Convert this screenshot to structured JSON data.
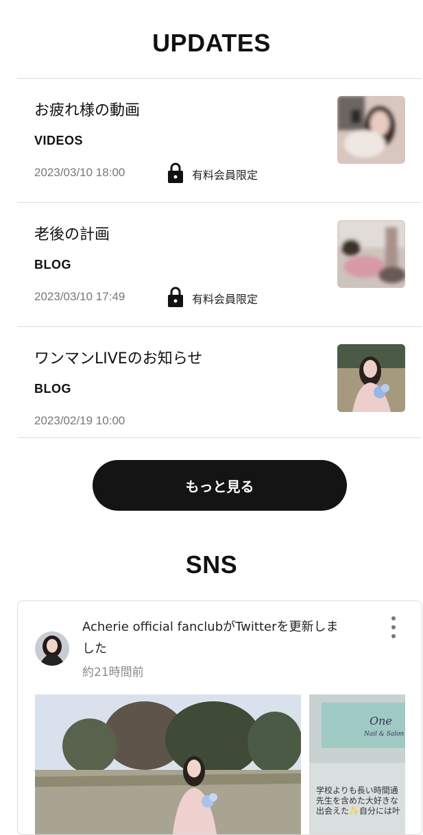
{
  "updates": {
    "title": "UPDATES",
    "items": [
      {
        "title": "お疲れ様の動画",
        "category": "VIDEOS",
        "date": "2023/03/10 18:00",
        "locked": true,
        "lock_label": "有料会員限定"
      },
      {
        "title": "老後の計画",
        "category": "BLOG",
        "date": "2023/03/10 17:49",
        "locked": true,
        "lock_label": "有料会員限定"
      },
      {
        "title": "ワンマンLIVEのお知らせ",
        "category": "BLOG",
        "date": "2023/02/19 10:00",
        "locked": false
      }
    ],
    "more_button_label": "もっと見る"
  },
  "sns": {
    "title": "SNS",
    "post": {
      "text": "Acherie official fanclubがTwitterを更新しました",
      "time": "約21時間前",
      "photo2_lines": [
        "学校よりも長い時間通",
        "先生を含めた大好きな",
        "出会えた✨自分には叶"
      ]
    }
  },
  "icons": {
    "lock": "lock-icon",
    "more": "more-vertical-icon"
  },
  "colors": {
    "button_bg": "#141414",
    "divider": "#dcdcdc",
    "date_text": "#777777"
  }
}
